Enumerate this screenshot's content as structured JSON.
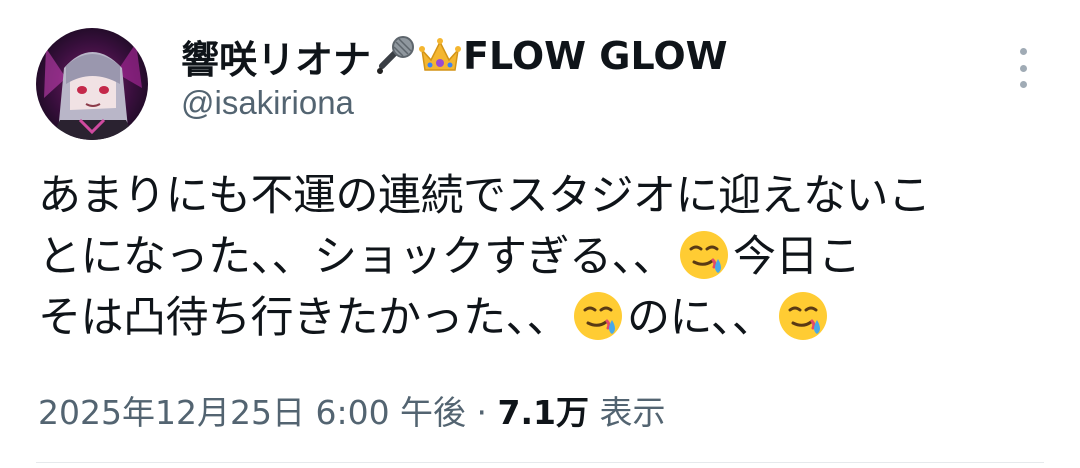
{
  "author": {
    "display_name_part1": "響咲リオナ",
    "display_name_part2": "FLOW GLOW",
    "name_icons": [
      "microphone-icon",
      "crown-icon"
    ],
    "handle": "@isakiriona"
  },
  "tweet": {
    "line1": "あまりにも不運の連続でスタジオに迎えないこ",
    "line2_a": "とになった、、ショックすぎる、、",
    "line2_b": "今日こ",
    "line3_a": "そは凸待ち行きたかった、、",
    "line3_b": "のに、、",
    "emoji_name": "face-holding-back-tears-icon"
  },
  "meta": {
    "timestamp": "2025年12月25日 6:00 午後",
    "separator": " · ",
    "views_count": "7.1万",
    "views_label": "表示"
  },
  "colors": {
    "text_primary": "#0f1419",
    "text_secondary": "#536471",
    "divider": "#e6e9ec"
  }
}
